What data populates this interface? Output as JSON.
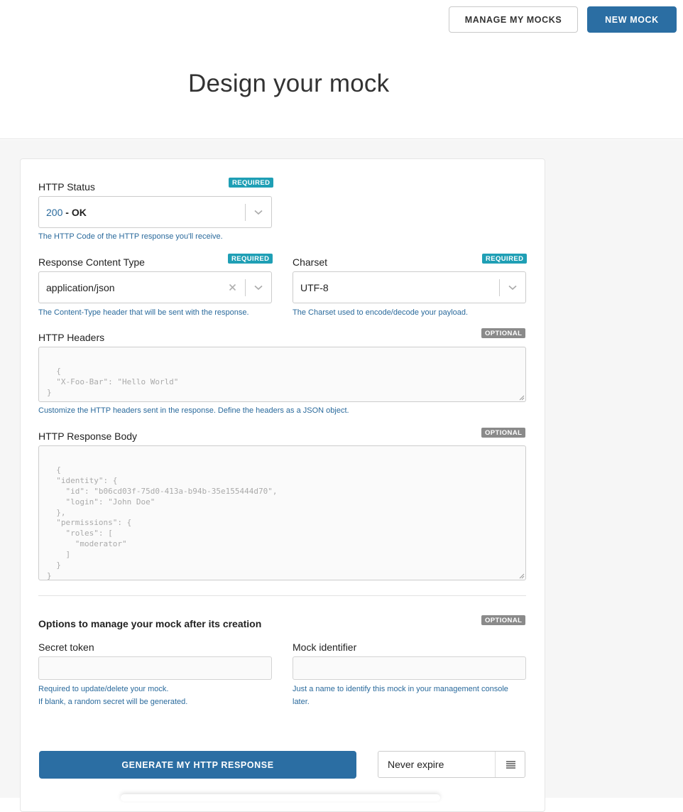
{
  "header": {
    "manage_label": "MANAGE MY MOCKS",
    "new_label": "NEW MOCK",
    "title": "Design your mock"
  },
  "form": {
    "http_status": {
      "label": "HTTP Status",
      "badge": "REQUIRED",
      "code": "200",
      "separator": " - ",
      "text": "OK",
      "help": "The HTTP Code of the HTTP response you'll receive."
    },
    "content_type": {
      "label": "Response Content Type",
      "badge": "REQUIRED",
      "value": "application/json",
      "help": "The Content-Type header that will be sent with the response."
    },
    "charset": {
      "label": "Charset",
      "badge": "REQUIRED",
      "value": "UTF-8",
      "help": "The Charset used to encode/decode your payload."
    },
    "headers": {
      "label": "HTTP Headers",
      "badge": "OPTIONAL",
      "placeholder": "{\n  \"X-Foo-Bar\": \"Hello World\"\n}",
      "help": "Customize the HTTP headers sent in the response. Define the headers as a JSON object."
    },
    "body": {
      "label": "HTTP Response Body",
      "badge": "OPTIONAL",
      "placeholder": "{\n  \"identity\": {\n    \"id\": \"b06cd03f-75d0-413a-b94b-35e155444d70\",\n    \"login\": \"John Doe\"\n  },\n  \"permissions\": {\n    \"roles\": [\n      \"moderator\"\n    ]\n  }\n}"
    },
    "options": {
      "title": "Options to manage your mock after its creation",
      "badge": "OPTIONAL",
      "secret": {
        "label": "Secret token",
        "value": "",
        "help_line1": "Required to update/delete your mock.",
        "help_line2": "If blank, a random secret will be generated."
      },
      "identifier": {
        "label": "Mock identifier",
        "value": "",
        "help_line1": "Just a name to identify this mock in your management console",
        "help_line2": "later."
      }
    },
    "generate_label": "GENERATE MY HTTP RESPONSE",
    "expiration": "Never expire"
  }
}
